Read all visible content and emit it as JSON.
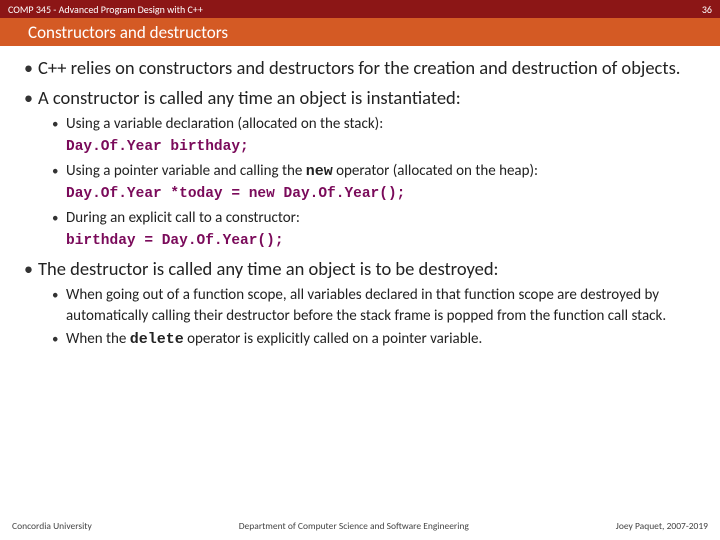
{
  "header": {
    "course": "COMP 345 - Advanced Program Design with C++",
    "page": "36",
    "title": "Constructors and destructors"
  },
  "body": {
    "p1": "C++ relies on constructors and destructors for the creation and destruction of objects.",
    "p2": "A constructor is called any time an object is instantiated:",
    "sub2": {
      "a": "Using a variable declaration (allocated on the stack):",
      "a_code": "Day.Of.Year birthday;",
      "b_pre": "Using a pointer variable and calling the ",
      "b_kw": "new",
      "b_post": "  operator (allocated on the heap):",
      "b_code": "Day.Of.Year *today = new Day.Of.Year();",
      "c": "During an explicit call to a constructor:",
      "c_code": "birthday = Day.Of.Year();"
    },
    "p3": "The destructor is called any time an object is to be destroyed:",
    "sub3": {
      "a": "When going out of a function scope, all variables declared in that function scope are destroyed by automatically calling their destructor before the stack frame is popped from the function call stack.",
      "b_pre": "When the ",
      "b_kw": "delete",
      "b_post": " operator is explicitly called on a pointer variable."
    }
  },
  "footer": {
    "left": "Concordia University",
    "center": "Department of Computer Science and Software Engineering",
    "right": "Joey Paquet, 2007-2019"
  }
}
